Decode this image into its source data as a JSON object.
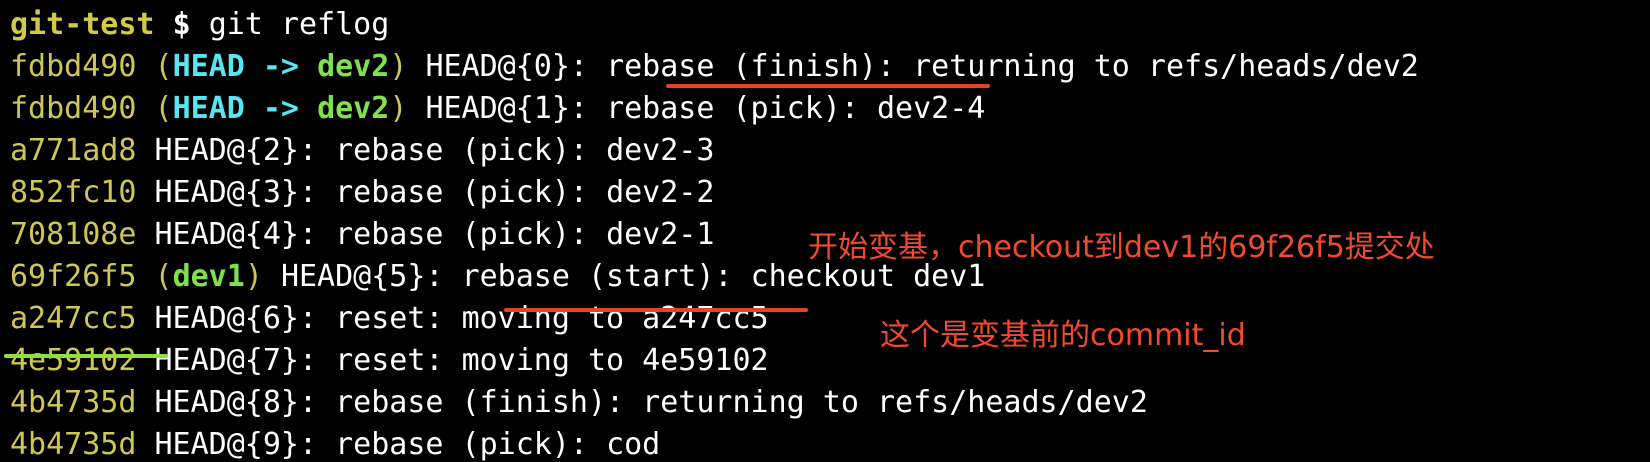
{
  "colors": {
    "background": "#000000",
    "hash": "#cfc754",
    "head_ref": "#58e6f0",
    "branch": "#7fe050",
    "text": "#ffffff",
    "annotation": "#f04a2f",
    "red_mark": "#e8402a",
    "green_mark": "#8fe03a"
  },
  "prompt": {
    "dir": "git-test",
    "sign": "$",
    "command": "git reflog"
  },
  "entries": [
    {
      "hash": "fdbd490",
      "head": "HEAD",
      "arrow": "->",
      "branch": "dev2",
      "ref": "HEAD@{0}:",
      "action": "rebase (finish):",
      "message": "returning to refs/heads/dev2"
    },
    {
      "hash": "fdbd490",
      "head": "HEAD",
      "arrow": "->",
      "branch": "dev2",
      "ref": "HEAD@{1}:",
      "action": "rebase (pick):",
      "message": "dev2-4"
    },
    {
      "hash": "a771ad8",
      "ref": "HEAD@{2}:",
      "action": "rebase (pick):",
      "message": "dev2-3"
    },
    {
      "hash": "852fc10",
      "ref": "HEAD@{3}:",
      "action": "rebase (pick):",
      "message": "dev2-2"
    },
    {
      "hash": "708108e",
      "ref": "HEAD@{4}:",
      "action": "rebase (pick):",
      "message": "dev2-1"
    },
    {
      "hash": "69f26f5",
      "branch": "dev1",
      "ref": "HEAD@{5}:",
      "action": "rebase (start):",
      "message": "checkout dev1"
    },
    {
      "hash": "a247cc5",
      "ref": "HEAD@{6}:",
      "action": "reset:",
      "message": "moving to a247cc5"
    },
    {
      "hash": "4e59102",
      "ref": "HEAD@{7}:",
      "action": "reset:",
      "message": "moving to 4e59102"
    },
    {
      "hash": "4b4735d",
      "ref": "HEAD@{8}:",
      "action": "rebase (finish):",
      "message": "returning to refs/heads/dev2"
    },
    {
      "hash": "4b4735d",
      "ref": "HEAD@{9}:",
      "action": "rebase (pick):",
      "message": "cod"
    }
  ],
  "annotations": {
    "rebase_start": "开始变基，checkout到dev1的69f26f5提交处",
    "before_rebase": "这个是变基前的commit_id"
  }
}
